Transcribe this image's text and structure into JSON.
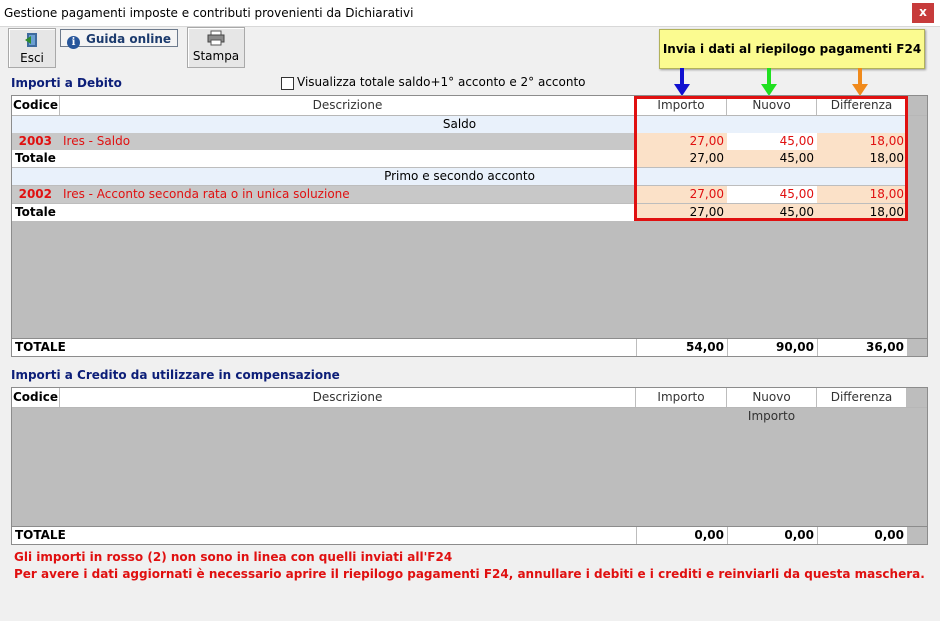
{
  "window": {
    "title": "Gestione pagamenti imposte e contributi provenienti da Dichiarativi",
    "close_label": "x"
  },
  "toolbar": {
    "esci_label": "Esci",
    "guida_label": "Guida online",
    "stampa_label": "Stampa",
    "f24_label": "Invia i dati al riepilogo pagamenti F24"
  },
  "debito": {
    "title": "Importi a Debito",
    "checkbox_label": "Visualizza totale saldo+1° acconto e 2° acconto",
    "checkbox_checked": false,
    "columns": {
      "codice": "Codice",
      "descrizione": "Descrizione",
      "importo": "Importo",
      "nuovo_importo": "Nuovo Importo",
      "differenza": "Differenza"
    },
    "groups": [
      {
        "label": "Saldo",
        "row": {
          "codice": "2003",
          "descrizione": "Ires - Saldo",
          "importo": "27,00",
          "nuovo_importo": "45,00",
          "differenza": "18,00"
        },
        "totale": {
          "label": "Totale",
          "importo": "27,00",
          "nuovo_importo": "45,00",
          "differenza": "18,00"
        }
      },
      {
        "label": "Primo e secondo acconto",
        "row": {
          "codice": "2002",
          "descrizione": "Ires - Acconto seconda rata o in unica soluzione",
          "importo": "27,00",
          "nuovo_importo": "45,00",
          "differenza": "18,00"
        },
        "totale": {
          "label": "Totale",
          "importo": "27,00",
          "nuovo_importo": "45,00",
          "differenza": "18,00"
        }
      }
    ],
    "grand_total": {
      "label": "TOTALE",
      "importo": "54,00",
      "nuovo_importo": "90,00",
      "differenza": "36,00"
    }
  },
  "credito": {
    "title": "Importi a Credito da utilizzare in compensazione",
    "columns": {
      "codice": "Codice",
      "descrizione": "Descrizione",
      "importo": "Importo",
      "nuovo_importo": "Nuovo Importo",
      "differenza": "Differenza"
    },
    "grand_total": {
      "label": "TOTALE",
      "importo": "0,00",
      "nuovo_importo": "0,00",
      "differenza": "0,00"
    }
  },
  "notes": {
    "line1": "Gli importi in rosso (2) non sono in linea con quelli inviati all'F24",
    "line2": "Per avere i dati aggiornati è necessario aprire il riepilogo pagamenti F24, annullare i debiti e i crediti e reinviarli da questa maschera."
  },
  "colors": {
    "arrow_importo": "#1010d0",
    "arrow_nuovo": "#20e020",
    "arrow_differenza": "#f08a1c",
    "highlight_box": "#e01010",
    "f24_button": "#fbfb90"
  }
}
